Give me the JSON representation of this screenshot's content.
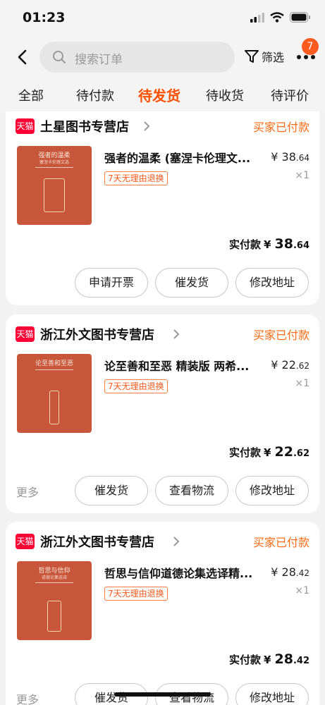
{
  "status_bar": {
    "time": "01:23"
  },
  "header": {
    "search_placeholder": "搜索订单",
    "filter_label": "筛选",
    "notification_count": "7"
  },
  "tabs": [
    {
      "label": "全部"
    },
    {
      "label": "待付款"
    },
    {
      "label": "待发货",
      "active": true
    },
    {
      "label": "待收货"
    },
    {
      "label": "待评价"
    }
  ],
  "colors": {
    "accent": "#ff5000",
    "tmall_red": "#ff0036",
    "status_orange": "#ff6a14"
  },
  "orders": [
    {
      "tmall_logo": "天猫",
      "shop_name": "土星图书专营店",
      "status": "买家已付款",
      "book_cover_text": "强者的温柔",
      "book_cover_sub": "塞涅卡伦理文选",
      "item_title": "强者的温柔 (塞涅卡伦理文...",
      "price_symbol": "¥",
      "price_int": "38",
      "price_dec": ".64",
      "quantity": "×1",
      "tag": "7天无理由退换",
      "paid_label": "实付款",
      "paid_symbol": "¥",
      "paid_int": "38",
      "paid_dec": ".64",
      "buttons": [
        "申请开票",
        "催发货",
        "修改地址"
      ]
    },
    {
      "tmall_logo": "天猫",
      "shop_name": "浙江外文图书专营店",
      "status": "买家已付款",
      "book_cover_text": "论至善和至恶",
      "item_title": "论至善和至恶 精装版 两希...",
      "price_symbol": "¥",
      "price_int": "22",
      "price_dec": ".62",
      "quantity": "×1",
      "tag": "7天无理由退换",
      "paid_label": "实付款",
      "paid_symbol": "¥",
      "paid_int": "22",
      "paid_dec": ".62",
      "more_label": "更多",
      "buttons": [
        "催发货",
        "查看物流",
        "修改地址"
      ]
    },
    {
      "tmall_logo": "天猫",
      "shop_name": "浙江外文图书专营店",
      "status": "买家已付款",
      "book_cover_text": "哲思与信仰",
      "book_cover_sub": "道德论集选译",
      "item_title": "哲思与信仰道德论集选译精...",
      "price_symbol": "¥",
      "price_int": "28",
      "price_dec": ".42",
      "quantity": "×1",
      "tag": "7天无理由退换",
      "paid_label": "实付款",
      "paid_symbol": "¥",
      "paid_int": "28",
      "paid_dec": ".42",
      "more_label": "更多",
      "buttons": [
        "催发货",
        "查看物流",
        "修改地址"
      ]
    }
  ]
}
